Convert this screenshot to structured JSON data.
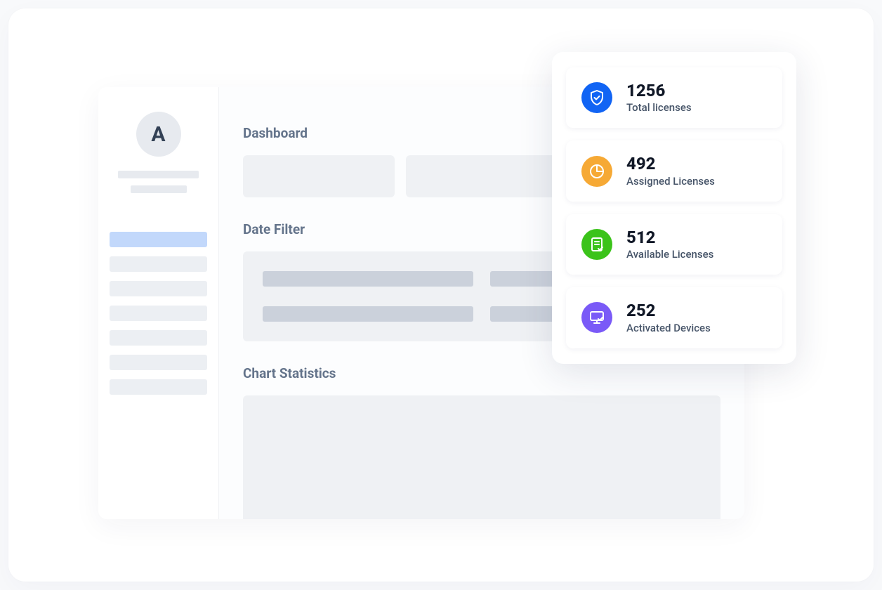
{
  "sidebar": {
    "avatar_initial": "A"
  },
  "sections": {
    "dashboard_title": "Dashboard",
    "date_filter_title": "Date Filter",
    "chart_title": "Chart Statistics"
  },
  "stats": {
    "total_licenses": {
      "value": "1256",
      "label": "Total licenses",
      "icon": "shield-check-icon",
      "color": "blue"
    },
    "assigned_licenses": {
      "value": "492",
      "label": "Assigned Licenses",
      "icon": "pie-icon",
      "color": "orange"
    },
    "available_licenses": {
      "value": "512",
      "label": "Available Licenses",
      "icon": "document-check-icon",
      "color": "green"
    },
    "activated_devices": {
      "value": "252",
      "label": "Activated Devices",
      "icon": "monitor-check-icon",
      "color": "purple"
    }
  }
}
